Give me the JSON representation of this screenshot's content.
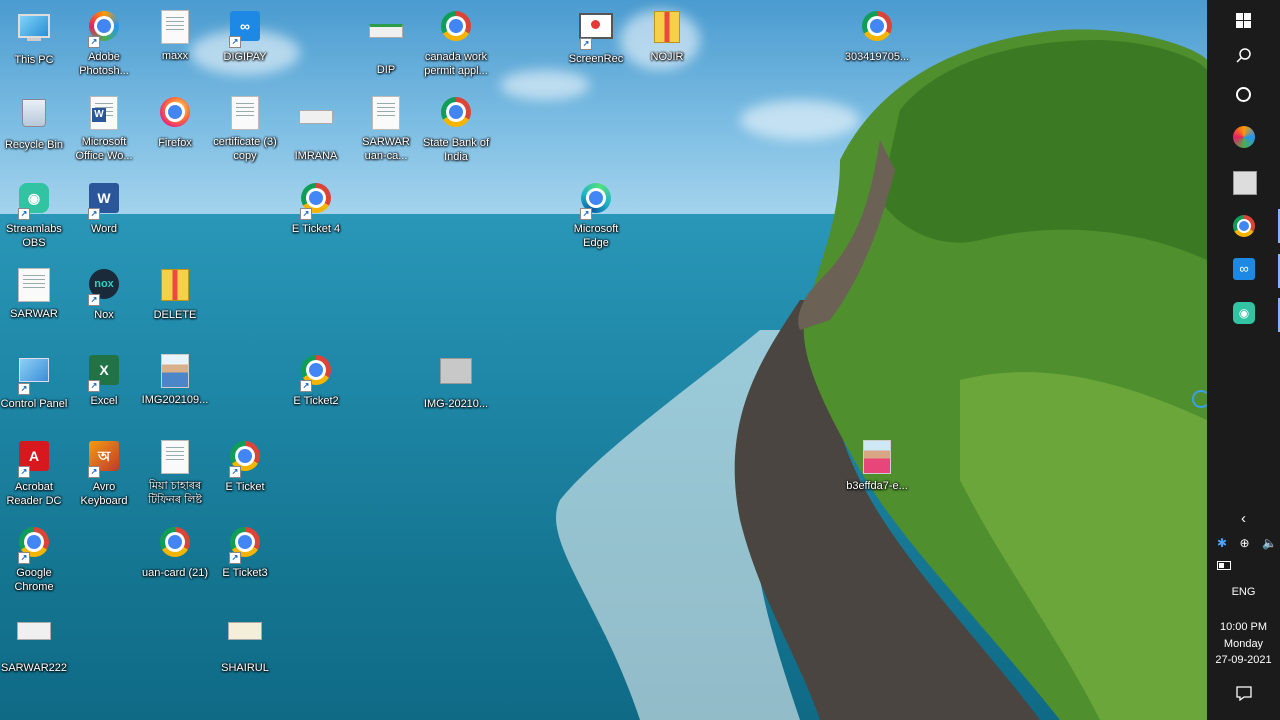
{
  "desktop": {
    "icons": {
      "this_pc": "This PC",
      "adobe_photoshop": "Adobe Photosh...",
      "maxx": "maxx",
      "digipay": "DIGIPAY",
      "dip": "DIP",
      "canada_work_permit": "canada work permit appl...",
      "screenrec": "ScreenRec",
      "nojir": "NOJIR",
      "chrome_303419705": "303419705...",
      "recycle_bin": "Recycle Bin",
      "microsoft_office_word": "Microsoft Office Wo...",
      "firefox": "Firefox",
      "certificate_copy": "certificate (3) copy",
      "imrana": "IMRANA",
      "sarwar_uan_ca": "SARWAR uan-ca...",
      "state_bank_of_india": "State Bank of India",
      "streamlabs_obs": "Streamlabs OBS",
      "word": "Word",
      "e_ticket_4": "E Ticket 4",
      "microsoft_edge": "Microsoft Edge",
      "sarwar": "SARWAR",
      "nox": "Nox",
      "delete": "DELETE",
      "control_panel": "Control Panel",
      "excel": "Excel",
      "img202109": "IMG202109...",
      "e_ticket2": "E Ticket2",
      "img_20210": "IMG-20210...",
      "acrobat_reader_dc": "Acrobat Reader DC",
      "avro_keyboard": "Avro Keyboard",
      "miya_file": "মিয়া চাহাৰৰ টিফিনৰ লিষ্ট",
      "e_ticket": "E Ticket",
      "b3effda7": "b3effda7-e...",
      "google_chrome": "Google Chrome",
      "uan_card_21": "uan-card (21)",
      "e_ticket3": "E Ticket3",
      "sarwar222": "SARWAR222",
      "shairul": "SHAIRUL"
    }
  },
  "taskbar": {
    "background": "#1b1b1b",
    "start_icon": "windows-logo-icon",
    "search_icon": "search-icon",
    "cortana_icon": "cortana-icon",
    "pinned_apps": [
      "photoshop-icon",
      "file-manager-icon",
      "chrome-icon",
      "digipay-icon",
      "streamlabs-icon"
    ],
    "tray": {
      "chevron": "‹",
      "language": "ENG",
      "time": "10:00 PM",
      "day": "Monday",
      "date": "27-09-2021"
    }
  }
}
